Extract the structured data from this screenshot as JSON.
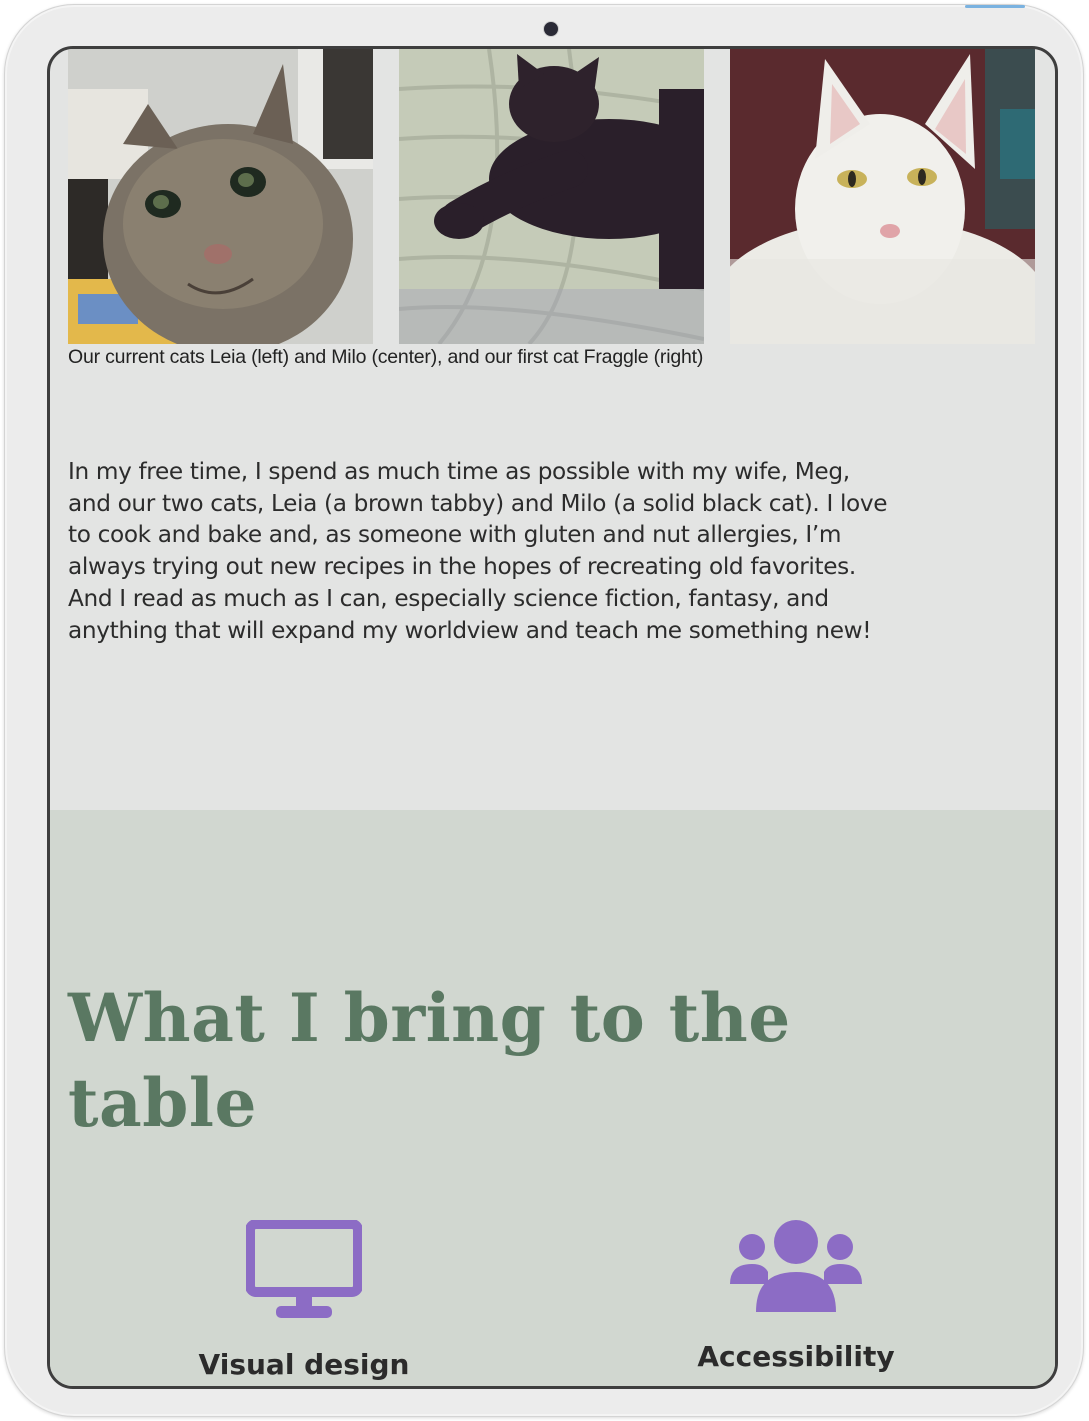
{
  "photos": [
    {
      "alt": "Leia, a brown tabby cat",
      "icon": "tabby-cat-photo"
    },
    {
      "alt": "Milo, a solid black cat",
      "icon": "black-cat-photo"
    },
    {
      "alt": "Fraggle, a white cat",
      "icon": "white-cat-photo"
    }
  ],
  "caption": "Our current cats Leia (left) and Milo (center), and our first cat Fraggle (right)",
  "bio": {
    "lines": [
      "In my free time, I spend as much time as possible with my wife, Meg,",
      "and our two cats, Leia (a brown tabby) and Milo (a solid black cat). I love",
      "to cook and bake and, as someone with gluten and nut allergies, I’m",
      "always trying out new recipes in the hopes of recreating old favorites.",
      "And I read as much as I can, especially science fiction, fantasy, and",
      "anything that will expand my worldview and teach me something new!"
    ]
  },
  "section": {
    "heading_line1": "What I bring to the",
    "heading_line2": "table",
    "skills": [
      {
        "label": "Visual design",
        "icon": "monitor-icon"
      },
      {
        "label": "Accessibility",
        "icon": "users-group-icon"
      }
    ]
  },
  "colors": {
    "screen_bg": "#e3e4e3",
    "section_bg": "#d1d7d0",
    "heading": "#5a7862",
    "icon_purple": "#8c6cc5"
  }
}
